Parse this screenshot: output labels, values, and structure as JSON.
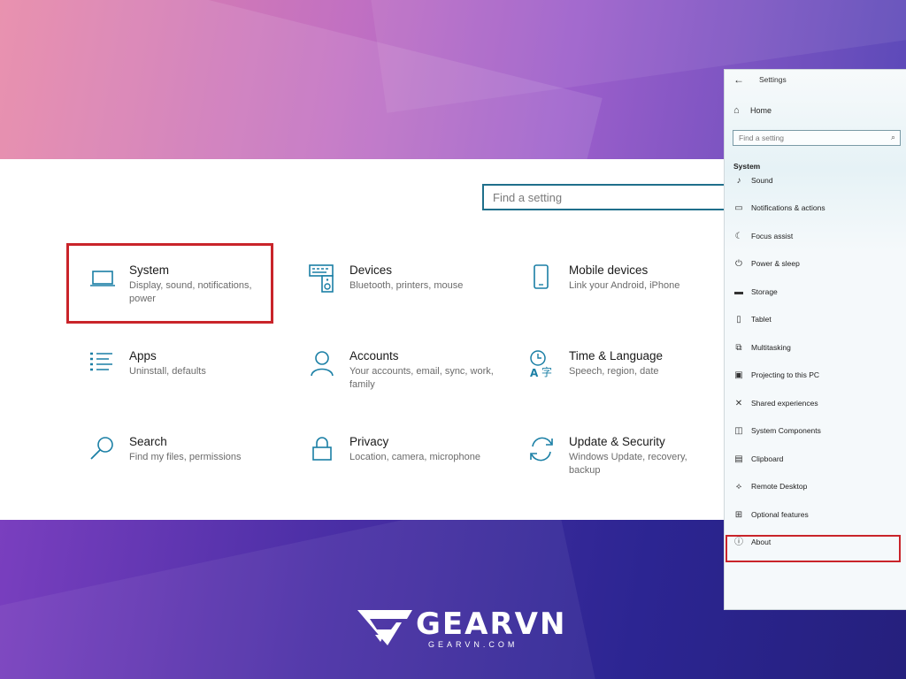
{
  "main": {
    "search_placeholder": "Find a setting",
    "categories": [
      {
        "title": "System",
        "desc": "Display, sound, notifications, power"
      },
      {
        "title": "Devices",
        "desc": "Bluetooth, printers, mouse"
      },
      {
        "title": "Mobile devices",
        "desc": "Link your Android, iPhone"
      },
      {
        "title": "Apps",
        "desc": "Uninstall, defaults"
      },
      {
        "title": "Accounts",
        "desc": "Your accounts, email, sync, work, family"
      },
      {
        "title": "Time & Language",
        "desc": "Speech, region, date"
      },
      {
        "title": "Search",
        "desc": "Find my files, permissions"
      },
      {
        "title": "Privacy",
        "desc": "Location, camera, microphone"
      },
      {
        "title": "Update & Security",
        "desc": "Windows Update, recovery, backup"
      }
    ]
  },
  "panel": {
    "back": "←",
    "title": "Settings",
    "home": "Home",
    "search_placeholder": "Find a setting",
    "section": "System",
    "items": [
      {
        "label": "Sound",
        "icon": "speaker-icon"
      },
      {
        "label": "Notifications & actions",
        "icon": "notification-icon"
      },
      {
        "label": "Focus assist",
        "icon": "moon-icon"
      },
      {
        "label": "Power & sleep",
        "icon": "power-icon"
      },
      {
        "label": "Storage",
        "icon": "storage-icon"
      },
      {
        "label": "Tablet",
        "icon": "tablet-icon"
      },
      {
        "label": "Multitasking",
        "icon": "multitasking-icon"
      },
      {
        "label": "Projecting to this PC",
        "icon": "projecting-icon"
      },
      {
        "label": "Shared experiences",
        "icon": "shared-icon"
      },
      {
        "label": "System Components",
        "icon": "components-icon"
      },
      {
        "label": "Clipboard",
        "icon": "clipboard-icon"
      },
      {
        "label": "Remote Desktop",
        "icon": "remote-icon"
      },
      {
        "label": "Optional features",
        "icon": "features-icon"
      },
      {
        "label": "About",
        "icon": "info-icon"
      }
    ]
  },
  "logo": {
    "word": "GEARVN",
    "sub": "GEARVN.COM"
  },
  "colors": {
    "accent": "#1f6f8b",
    "icon": "#1a7fa5",
    "highlight": "#c9242a"
  }
}
